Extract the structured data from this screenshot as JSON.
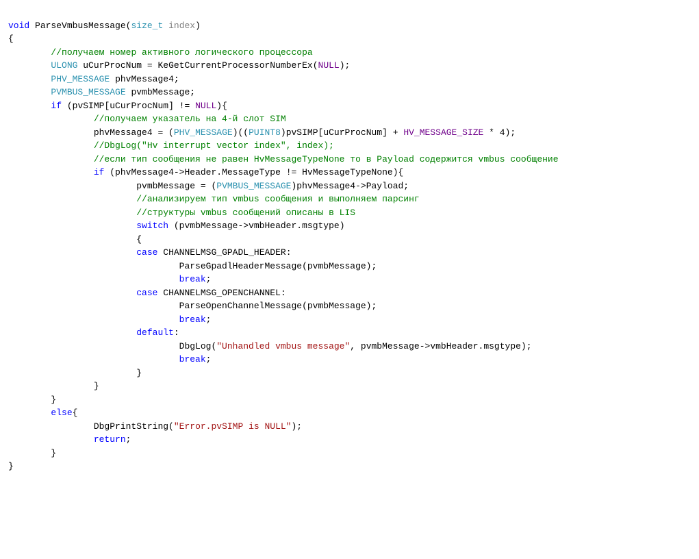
{
  "line1": {
    "void": "void",
    "fn": "ParseVmbusMessage",
    "ptype": "size_t",
    "pname": "index"
  },
  "line2": "{",
  "line3": "//получаем номер активного логического процессора",
  "line4": {
    "t": "ULONG",
    "r1": "uCurProcNum = KeGetCurrentProcessorNumberEx(",
    "null": "NULL",
    "r2": ");"
  },
  "line5": {
    "t": "PHV_MESSAGE",
    "r": "phvMessage4;"
  },
  "line6": {
    "t": "PVMBUS_MESSAGE",
    "r": "pvmbMessage;"
  },
  "line7": {
    "kw": "if",
    "r1": "(pvSIMP[uCurProcNum] != ",
    "null": "NULL",
    "r2": "){"
  },
  "line8": "//получаем указатель на 4-й слот SIM",
  "line9": {
    "a": "phvMessage4 = (",
    "t1": "PHV_MESSAGE",
    "b": ")((",
    "t2": "PUINT8",
    "c": ")pvSIMP[uCurProcNum] + ",
    "cst": "HV_MESSAGE_SIZE",
    "d": " * 4);"
  },
  "line10": "//DbgLog(\"Hv interrupt vector index\", index);",
  "line11": "//если тип сообщения не равен HvMessageTypeNone то в Payload содержится vmbus сообщение",
  "line12": {
    "kw": "if",
    "r": "(phvMessage4->Header.MessageType != HvMessageTypeNone){"
  },
  "line13": {
    "a": "pvmbMessage = (",
    "t": "PVMBUS_MESSAGE",
    "b": ")phvMessage4->Payload;"
  },
  "line14": "//анализируем тип vmbus сообщения и выполняем парсинг",
  "line15": "//структуры vmbus сообщений описаны в LIS",
  "line16": {
    "kw": "switch",
    "r": "(pvmbMessage->vmbHeader.msgtype)"
  },
  "line17": "{",
  "line18": {
    "kw": "case",
    "r": "CHANNELMSG_GPADL_HEADER:"
  },
  "line19": "ParseGpadlHeaderMessage(pvmbMessage);",
  "line20": "break",
  "line21": {
    "kw": "case",
    "r": "CHANNELMSG_OPENCHANNEL:"
  },
  "line22": "ParseOpenChannelMessage(pvmbMessage);",
  "line23": "break",
  "line24": "default",
  "line25": {
    "a": "DbgLog(",
    "s": "\"Unhandled vmbus message\"",
    "b": ", pvmbMessage->vmbHeader.msgtype);"
  },
  "line26": "break",
  "line27": "}",
  "line28": "}",
  "line29": "}",
  "line30": {
    "kw": "else",
    "r": "{"
  },
  "line31": {
    "a": "DbgPrintString(",
    "s": "\"Error.pvSIMP is NULL\"",
    "b": ");"
  },
  "line32": "return",
  "line33": "}",
  "line34": "}"
}
